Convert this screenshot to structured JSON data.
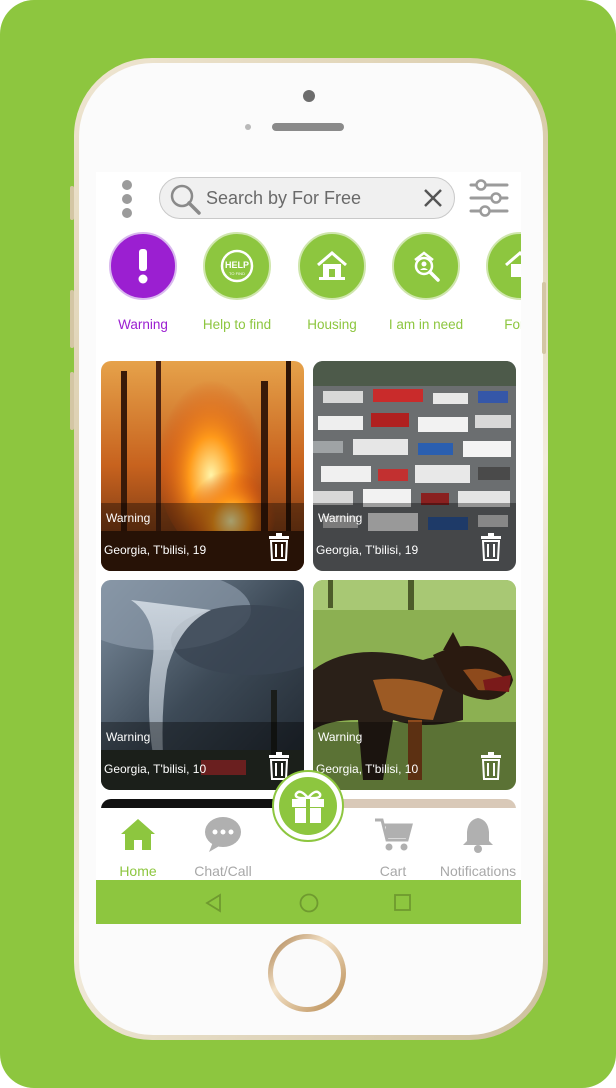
{
  "search": {
    "placeholder": "Search by For Free"
  },
  "categories": [
    {
      "label": "Warning",
      "icon": "exclamation-icon",
      "active": true
    },
    {
      "label": "Help to find",
      "icon": "help-badge-icon",
      "active": false
    },
    {
      "label": "Housing",
      "icon": "house-icon",
      "active": false
    },
    {
      "label": "I am in need",
      "icon": "magnifier-person-icon",
      "active": false
    },
    {
      "label": "For h",
      "icon": "house-icon",
      "active": false
    }
  ],
  "cards": [
    {
      "title": "Warning",
      "location": "Georgia, T'bilisi, 19",
      "image": "forest-fire"
    },
    {
      "title": "Warning",
      "location": "Georgia, T'bilisi, 19",
      "image": "traffic-jam"
    },
    {
      "title": "Warning",
      "location": "Georgia, T'bilisi, 10",
      "image": "tornado"
    },
    {
      "title": "Warning",
      "location": "Georgia, T'bilisi, 10",
      "image": "angry-dog"
    }
  ],
  "nav": {
    "home": "Home",
    "chat": "Chat/Call",
    "cart": "Cart",
    "notifications": "Notifications"
  },
  "colors": {
    "accent_green": "#8dc63f",
    "active_purple": "#9b1fd1",
    "inactive_gray": "#a8a8a8"
  }
}
